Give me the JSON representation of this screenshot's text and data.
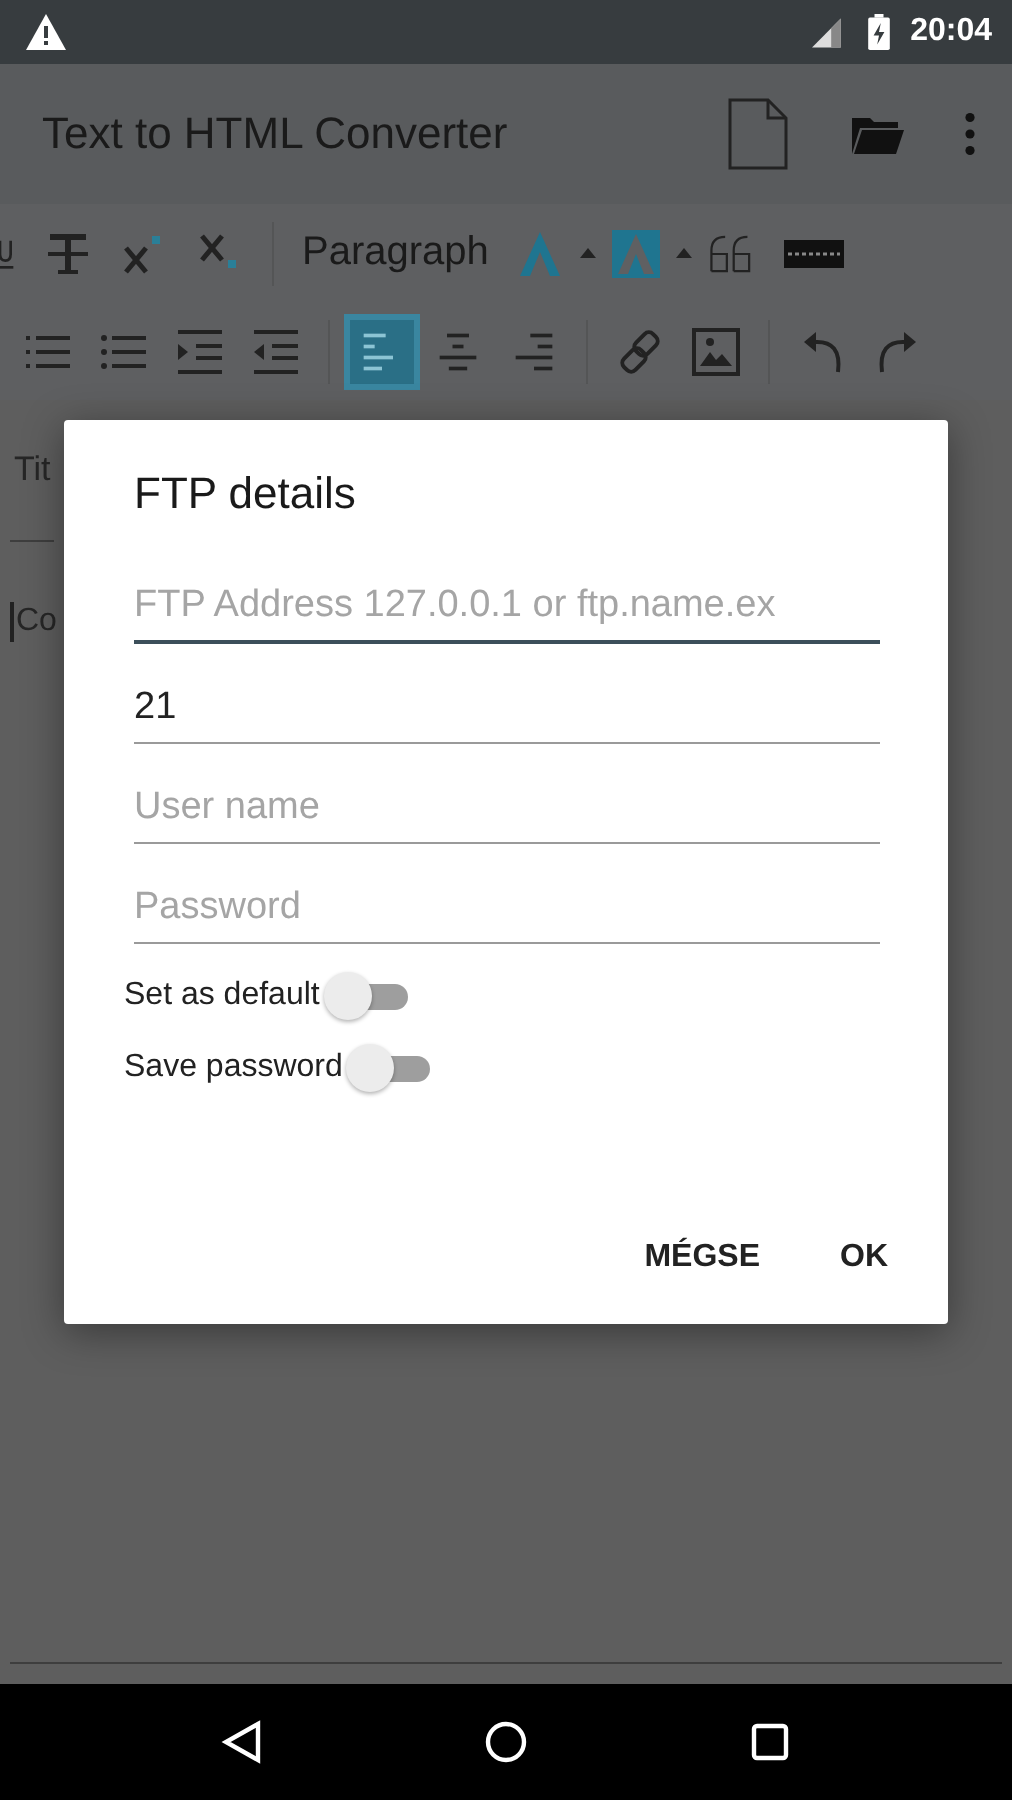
{
  "status_bar": {
    "time": "20:04"
  },
  "app_bar": {
    "title": "Text to HTML Converter"
  },
  "toolbar": {
    "style_dropdown": "Paragraph",
    "align_buttons": [
      {
        "selected": true
      },
      {
        "selected": false
      },
      {
        "selected": false
      }
    ]
  },
  "editor": {
    "title_placeholder": "Tit",
    "content_placeholder": "Co"
  },
  "dialog": {
    "title": "FTP details",
    "fields": [
      {
        "placeholder": "FTP Address 127.0.0.1 or ftp.name.ex",
        "focused": true
      },
      {
        "value": "21",
        "focused": false
      },
      {
        "placeholder": "User name",
        "focused": false
      },
      {
        "placeholder": "Password",
        "focused": false
      }
    ],
    "toggles": [
      {
        "label": "Set as default",
        "on": false
      },
      {
        "label": "Save password",
        "on": false
      }
    ],
    "buttons": [
      "MÉGSE",
      "OK"
    ]
  }
}
